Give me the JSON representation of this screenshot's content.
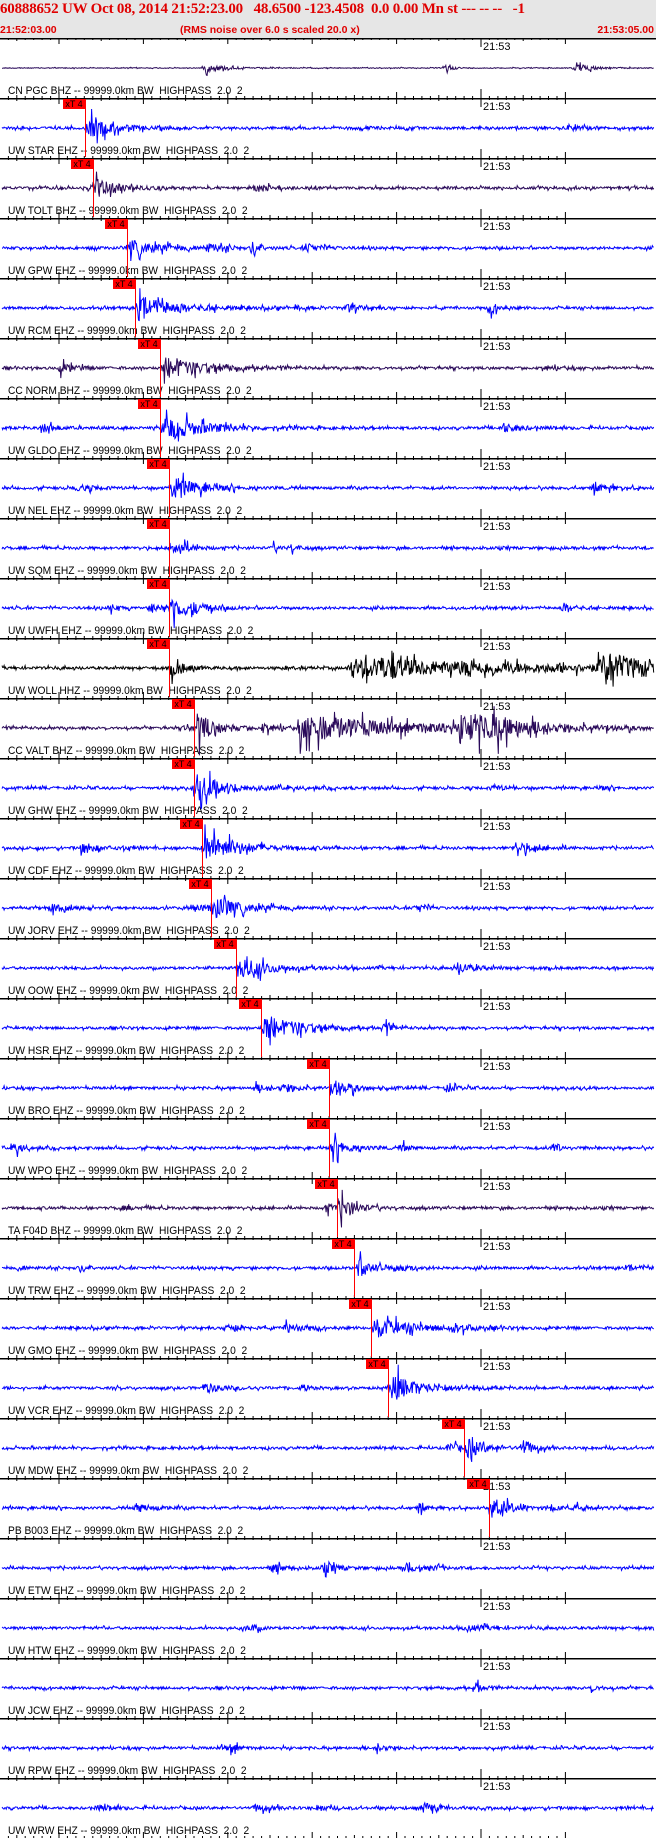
{
  "header": {
    "title": "60888652 UW Oct 08, 2014 21:52:23.00   48.6500 -123.4508  0.0 0.00 Mn st --- -- --   -1",
    "start_time": "21:52:03.00",
    "note": "(RMS noise over 6.0 s scaled 20.0 x)",
    "end_time": "21:53:05.00"
  },
  "time_label": "21:53",
  "pick_label": "xT 4",
  "colors": {
    "blue": "#0000ff",
    "purple": "#2a0a5a",
    "black": "#000000",
    "pick": "#ff0000",
    "title": "#e00000"
  },
  "traces": [
    {
      "label": "CN PGC BHZ -- 99999.0km BW  HIGHPASS  2.0  2",
      "color": "purple",
      "pick_s": null
    },
    {
      "label": "UW STAR EHZ -- 99999.0km BW  HIGHPASS  2.0  2",
      "color": "blue",
      "pick_s": 10.1
    },
    {
      "label": "UW TOLT BHZ -- 99999.0km BW  HIGHPASS  2.0  2",
      "color": "purple",
      "pick_s": 11.0
    },
    {
      "label": "UW GPW EHZ -- 99999.0km BW  HIGHPASS  2.0  2",
      "color": "blue",
      "pick_s": 15.0
    },
    {
      "label": "UW RCM EHZ -- 99999.0km BW  HIGHPASS  2.0  2",
      "color": "blue",
      "pick_s": 16.0
    },
    {
      "label": "CC NORM BHZ -- 99999.0km BW  HIGHPASS  2.0  2",
      "color": "purple",
      "pick_s": 19.0
    },
    {
      "label": "UW GLDO EHZ -- 99999.0km BW  HIGHPASS  2.0  2",
      "color": "blue",
      "pick_s": 19.0
    },
    {
      "label": "UW NEL EHZ -- 99999.0km BW  HIGHPASS  2.0  2",
      "color": "blue",
      "pick_s": 20.0
    },
    {
      "label": "UW SQM EHZ -- 99999.0km BW  HIGHPASS  2.0  2",
      "color": "blue",
      "pick_s": 20.0
    },
    {
      "label": "UW UWFH EHZ -- 99999.0km BW  HIGHPASS  2.0  2",
      "color": "blue",
      "pick_s": 20.0
    },
    {
      "label": "UW WOLL HHZ -- 99999.0km BW  HIGHPASS  2.0  2",
      "color": "black",
      "pick_s": 20.0
    },
    {
      "label": "CC VALT BHZ -- 99999.0km BW  HIGHPASS  2.0  2",
      "color": "purple",
      "pick_s": 23.0
    },
    {
      "label": "UW GHW EHZ -- 99999.0km BW  HIGHPASS  2.0  2",
      "color": "blue",
      "pick_s": 23.0
    },
    {
      "label": "UW CDF EHZ -- 99999.0km BW  HIGHPASS  2.0  2",
      "color": "blue",
      "pick_s": 23.9
    },
    {
      "label": "UW JORV EHZ -- 99999.0km BW  HIGHPASS  2.0  2",
      "color": "blue",
      "pick_s": 25.0
    },
    {
      "label": "UW OOW EHZ -- 99999.0km BW  HIGHPASS  2.0  2",
      "color": "blue",
      "pick_s": 28.0
    },
    {
      "label": "UW HSR EHZ -- 99999.0km BW  HIGHPASS  2.0  2",
      "color": "blue",
      "pick_s": 30.9
    },
    {
      "label": "UW BRO EHZ -- 99999.0km BW  HIGHPASS  2.0  2",
      "color": "blue",
      "pick_s": 39.0
    },
    {
      "label": "UW WPO EHZ -- 99999.0km BW  HIGHPASS  2.0  2",
      "color": "blue",
      "pick_s": 39.0
    },
    {
      "label": "TA F04D BHZ -- 99999.0km BW  HIGHPASS  2.0  2",
      "color": "purple",
      "pick_s": 39.9
    },
    {
      "label": "UW TRW EHZ -- 99999.0km BW  HIGHPASS  2.0  2",
      "color": "blue",
      "pick_s": 41.9
    },
    {
      "label": "UW GMO EHZ -- 99999.0km BW  HIGHPASS  2.0  2",
      "color": "blue",
      "pick_s": 44.0
    },
    {
      "label": "UW VCR EHZ -- 99999.0km BW  HIGHPASS  2.0  2",
      "color": "blue",
      "pick_s": 46.0
    },
    {
      "label": "UW MDW EHZ -- 99999.0km BW  HIGHPASS  2.0  2",
      "color": "blue",
      "pick_s": 55.0
    },
    {
      "label": "PB B003 EHZ -- 99999.0km BW  HIGHPASS  2.0  2",
      "color": "blue",
      "pick_s": 57.9
    },
    {
      "label": "UW ETW EHZ -- 99999.0km BW  HIGHPASS  2.0  2",
      "color": "blue",
      "pick_s": null
    },
    {
      "label": "UW HTW EHZ -- 99999.0km BW  HIGHPASS  2.0  2",
      "color": "blue",
      "pick_s": null
    },
    {
      "label": "UW JCW EHZ -- 99999.0km BW  HIGHPASS  2.0  2",
      "color": "blue",
      "pick_s": null
    },
    {
      "label": "UW RPW EHZ -- 99999.0km BW  HIGHPASS  2.0  2",
      "color": "blue",
      "pick_s": null
    },
    {
      "label": "UW WRW EHZ -- 99999.0km BW  HIGHPASS  2.0  2",
      "color": "blue",
      "pick_s": null
    }
  ]
}
